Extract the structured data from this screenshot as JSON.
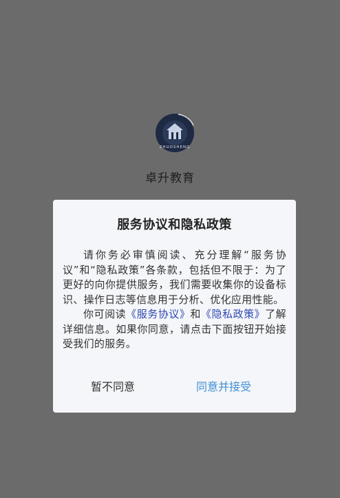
{
  "app": {
    "name": "卓升教育",
    "logo_text": "ZHUOSHENG"
  },
  "dialog": {
    "title": "服务协议和隐私政策",
    "para1": "请你务必审慎阅读、充分理解“服务协议”和“隐私政策”各条款，包括但不限于：为了更好的向你提供服务，我们需要收集你的设备标识、操作日志等信息用于分析、优化应用性能。",
    "para2_prefix": "你可阅读",
    "link_service": "《服务协议》",
    "para2_and": "和",
    "link_privacy": "《隐私政策》",
    "para2_suffix": "了解详细信息。如果你同意，请点击下面按钮开始接受我们的服务。",
    "decline_label": "暂不同意",
    "accept_label": "同意并接受"
  },
  "colors": {
    "overlay": "#6b6b6b",
    "dialog_bg": "#f5f6f9",
    "link": "#2f49b2",
    "accept": "#3e8fd4"
  }
}
